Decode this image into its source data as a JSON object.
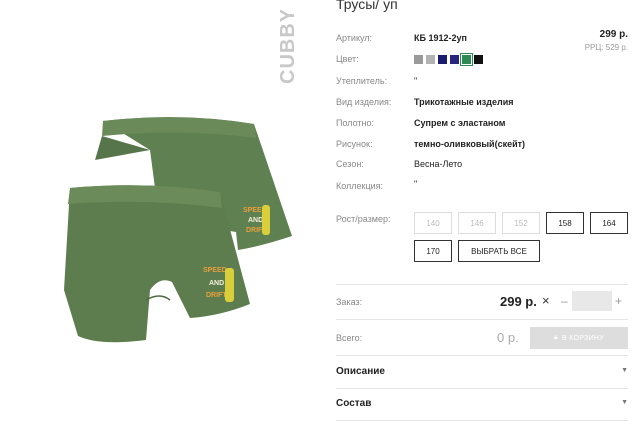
{
  "product": {
    "brand": "CUBBY",
    "title": "Трусы/ уп"
  },
  "details": {
    "article_label": "Артикул:",
    "article_value": "КБ 1912-2уп",
    "color_label": "Цвет:",
    "insulation_label": "Утеплитель:",
    "insulation_value": "\"",
    "type_label": "Вид изделия:",
    "type_value": "Трикотажные изделия",
    "fabric_label": "Полотно:",
    "fabric_value": "Супрем с эластаном",
    "pattern_label": "Рисунок:",
    "pattern_value": "темно-оливковый(скейт)",
    "season_label": "Сезон:",
    "season_value": "Весна-Лето",
    "collection_label": "Коллекция:",
    "collection_value": "\"",
    "size_label": "Рост/размер:"
  },
  "pricing": {
    "price": "299 р.",
    "rrp": "РРЦ: 529 р."
  },
  "swatches": [
    {
      "color": "#9a9a9a",
      "selected": false
    },
    {
      "color": "#b3b3b3",
      "selected": false
    },
    {
      "color": "#1c1c6e",
      "selected": false
    },
    {
      "color": "#262680",
      "selected": false
    },
    {
      "color": "#2d8a55",
      "selected": true
    },
    {
      "color": "#111111",
      "selected": false
    }
  ],
  "sizes": [
    {
      "label": "140",
      "disabled": true
    },
    {
      "label": "146",
      "disabled": true
    },
    {
      "label": "152",
      "disabled": true
    },
    {
      "label": "158",
      "disabled": false
    },
    {
      "label": "164",
      "disabled": false
    },
    {
      "label": "170",
      "disabled": false
    }
  ],
  "select_all_label": "ВЫБРАТЬ ВСЕ",
  "order": {
    "label": "Заказ:",
    "price": "299 р.",
    "times": "×",
    "minus": "–",
    "plus": "+",
    "qty": ""
  },
  "total": {
    "label": "Всего:",
    "value": "0 р.",
    "cart_label": "В КОРЗИНУ"
  },
  "accordion": {
    "description": "Описание",
    "composition": "Состав"
  },
  "colors": {
    "garment": "#5d7d4f",
    "garment_dark": "#4c6a40",
    "accent_green": "#2d8a55"
  }
}
